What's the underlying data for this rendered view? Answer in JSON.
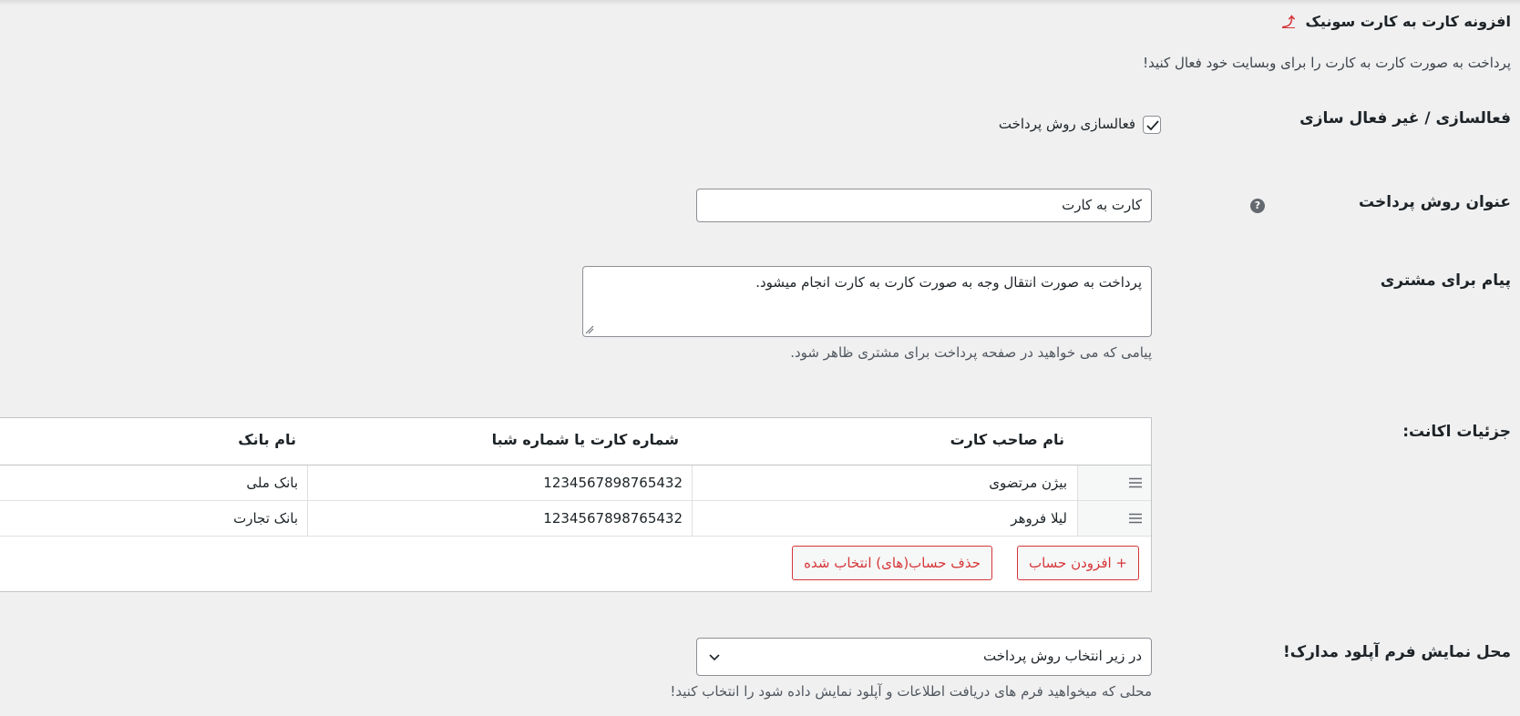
{
  "header": {
    "title": "افزونه کارت به کارت سونیک",
    "up_arrow": "⤴",
    "description": "پرداخت به صورت کارت به کارت را برای وبسایت خود فعال کنید!"
  },
  "fields": {
    "enable": {
      "label": "فعالسازی / غیر فعال سازی",
      "checkbox_label": "فعالسازی روش پرداخت",
      "checked": true
    },
    "title": {
      "label": "عنوان روش پرداخت",
      "help": "?",
      "value": "کارت به کارت"
    },
    "message": {
      "label": "پیام برای مشتری",
      "value": "پرداخت به صورت انتقال وجه به صورت کارت به کارت انجام میشود.",
      "hint": "پیامی که می خواهید در صفحه پرداخت برای مشتری ظاهر شود."
    },
    "accounts": {
      "label": "جزئیات اکانت:",
      "columns": [
        "نام صاحب کارت",
        "شماره کارت یا شماره شبا",
        "نام بانک"
      ],
      "rows": [
        {
          "holder": "بیژن مرتضوی",
          "number": "1234567898765432",
          "bank": "بانک ملی"
        },
        {
          "holder": "لیلا فروهر",
          "number": "1234567898765432",
          "bank": "بانک تجارت"
        }
      ],
      "add_button": "+ افزودن حساب",
      "remove_button": "حذف حساب(های) انتخاب شده"
    },
    "upload_location": {
      "label": "محل نمایش فرم آپلود مدارک!",
      "selected": "در زیر انتخاب روش پرداخت",
      "hint": "محلی که میخواهید فرم های دریافت اطلاعات و آپلود نمایش داده شود را انتخاب کنید!"
    }
  },
  "colors": {
    "accent_red": "#d63638",
    "background": "#f0f0f1"
  }
}
